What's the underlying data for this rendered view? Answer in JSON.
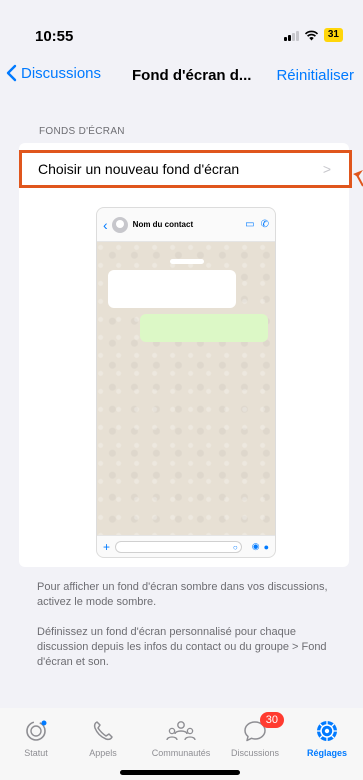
{
  "status": {
    "time": "10:55",
    "battery": "31"
  },
  "nav": {
    "back_label": "Discussions",
    "title": "Fond d'écran d...",
    "reset_label": "Réinitialiser"
  },
  "section": {
    "header": "FONDS D'ÉCRAN",
    "choose_label": "Choisir un nouveau fond d'écran"
  },
  "preview": {
    "contact_name": "Nom du contact"
  },
  "footnotes": [
    "Pour afficher un fond d'écran sombre dans vos discussions, activez le mode sombre.",
    "Définissez un fond d'écran personnalisé pour chaque discussion depuis les infos du contact ou du groupe > Fond d'écran et son."
  ],
  "tabs": [
    {
      "label": "Statut",
      "icon": "status-icon"
    },
    {
      "label": "Appels",
      "icon": "phone-icon"
    },
    {
      "label": "Communautés",
      "icon": "communities-icon"
    },
    {
      "label": "Discussions",
      "icon": "chat-icon",
      "badge": "30"
    },
    {
      "label": "Réglages",
      "icon": "settings-icon",
      "active": true
    }
  ],
  "colors": {
    "accent": "#007aff",
    "highlight": "#e0561d",
    "badge": "#ff3b30",
    "outgoing_bubble": "#dcf8c6"
  }
}
